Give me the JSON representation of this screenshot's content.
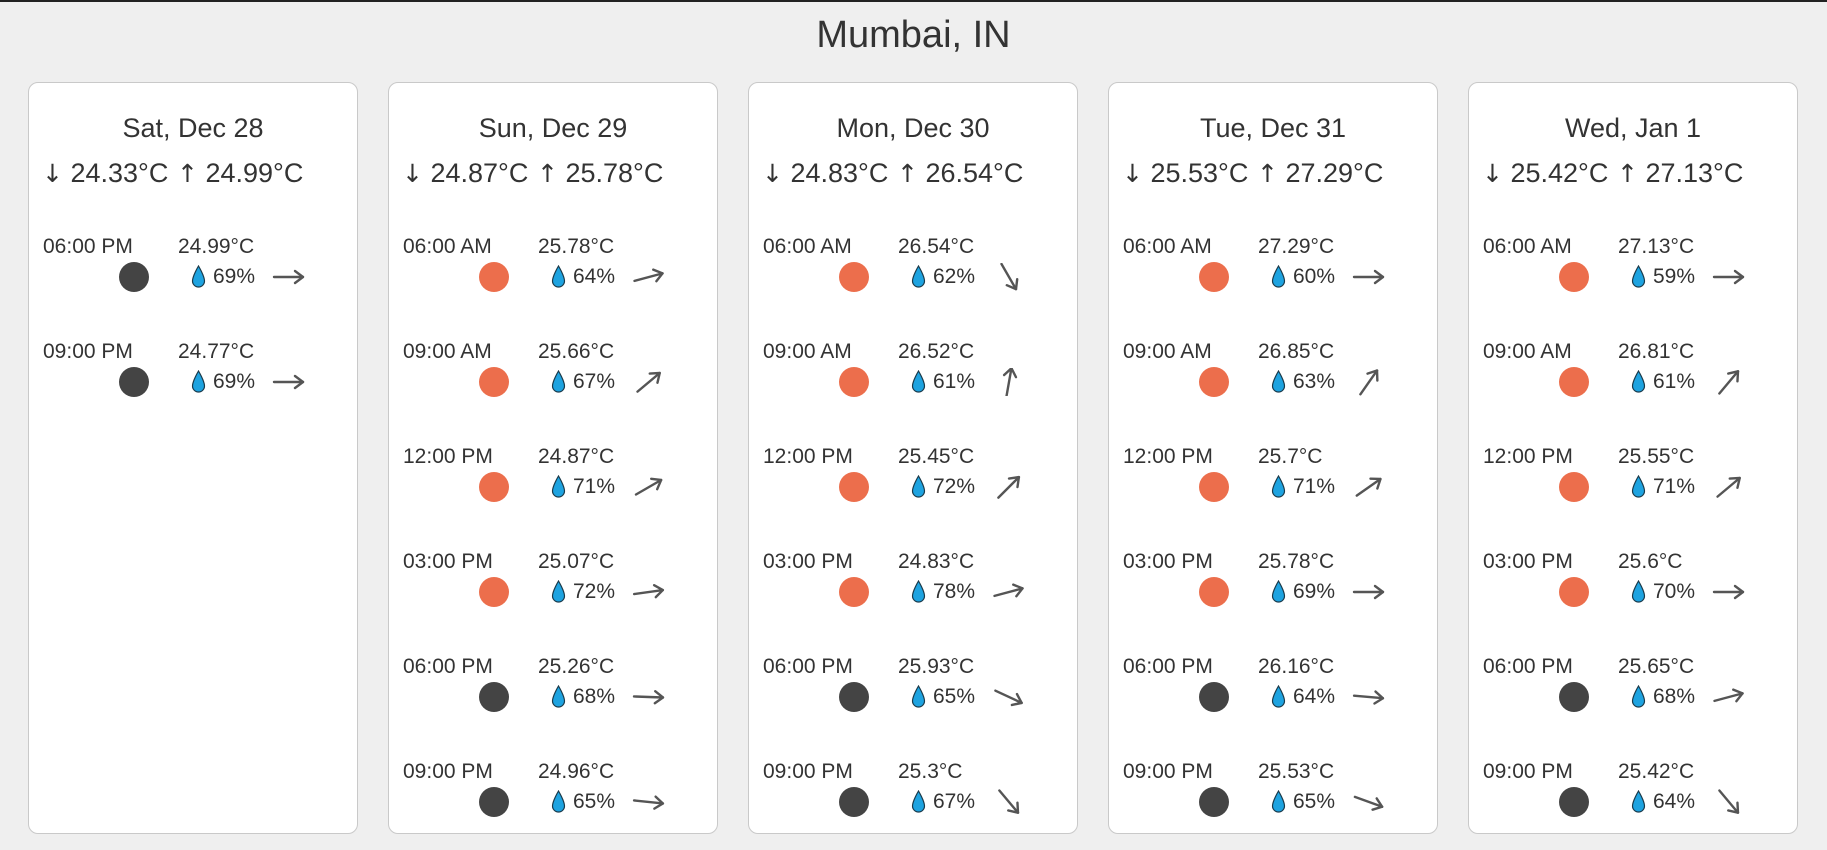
{
  "location": "Mumbai, IN",
  "colors": {
    "day": "#ec6e4c",
    "night": "#444444",
    "drop": "#1ea3e0",
    "arrow": "#555555"
  },
  "days": [
    {
      "date": "Sat, Dec 28",
      "min": "24.33°C",
      "max": "24.99°C",
      "slots": [
        {
          "time": "06:00 PM",
          "temp": "24.99°C",
          "humidity": "69%",
          "condition": "night",
          "wind_dir_deg": 0
        },
        {
          "time": "09:00 PM",
          "temp": "24.77°C",
          "humidity": "69%",
          "condition": "night",
          "wind_dir_deg": 0
        }
      ]
    },
    {
      "date": "Sun, Dec 29",
      "min": "24.87°C",
      "max": "25.78°C",
      "slots": [
        {
          "time": "06:00 AM",
          "temp": "25.78°C",
          "humidity": "64%",
          "condition": "day",
          "wind_dir_deg": -15
        },
        {
          "time": "09:00 AM",
          "temp": "25.66°C",
          "humidity": "67%",
          "condition": "day",
          "wind_dir_deg": -40
        },
        {
          "time": "12:00 PM",
          "temp": "24.87°C",
          "humidity": "71%",
          "condition": "day",
          "wind_dir_deg": -30
        },
        {
          "time": "03:00 PM",
          "temp": "25.07°C",
          "humidity": "72%",
          "condition": "day",
          "wind_dir_deg": -8
        },
        {
          "time": "06:00 PM",
          "temp": "25.26°C",
          "humidity": "68%",
          "condition": "night",
          "wind_dir_deg": 2
        },
        {
          "time": "09:00 PM",
          "temp": "24.96°C",
          "humidity": "65%",
          "condition": "night",
          "wind_dir_deg": 6
        }
      ]
    },
    {
      "date": "Mon, Dec 30",
      "min": "24.83°C",
      "max": "26.54°C",
      "slots": [
        {
          "time": "06:00 AM",
          "temp": "26.54°C",
          "humidity": "62%",
          "condition": "day",
          "wind_dir_deg": 60
        },
        {
          "time": "09:00 AM",
          "temp": "26.52°C",
          "humidity": "61%",
          "condition": "day",
          "wind_dir_deg": -80
        },
        {
          "time": "12:00 PM",
          "temp": "25.45°C",
          "humidity": "72%",
          "condition": "day",
          "wind_dir_deg": -45
        },
        {
          "time": "03:00 PM",
          "temp": "24.83°C",
          "humidity": "78%",
          "condition": "day",
          "wind_dir_deg": -15
        },
        {
          "time": "06:00 PM",
          "temp": "25.93°C",
          "humidity": "65%",
          "condition": "night",
          "wind_dir_deg": 25
        },
        {
          "time": "09:00 PM",
          "temp": "25.3°C",
          "humidity": "67%",
          "condition": "night",
          "wind_dir_deg": 50
        }
      ]
    },
    {
      "date": "Tue, Dec 31",
      "min": "25.53°C",
      "max": "27.29°C",
      "slots": [
        {
          "time": "06:00 AM",
          "temp": "27.29°C",
          "humidity": "60%",
          "condition": "day",
          "wind_dir_deg": 0
        },
        {
          "time": "09:00 AM",
          "temp": "26.85°C",
          "humidity": "63%",
          "condition": "day",
          "wind_dir_deg": -55
        },
        {
          "time": "12:00 PM",
          "temp": "25.7°C",
          "humidity": "71%",
          "condition": "day",
          "wind_dir_deg": -35
        },
        {
          "time": "03:00 PM",
          "temp": "25.78°C",
          "humidity": "69%",
          "condition": "day",
          "wind_dir_deg": 0
        },
        {
          "time": "06:00 PM",
          "temp": "26.16°C",
          "humidity": "64%",
          "condition": "night",
          "wind_dir_deg": 5
        },
        {
          "time": "09:00 PM",
          "temp": "25.53°C",
          "humidity": "65%",
          "condition": "night",
          "wind_dir_deg": 20
        }
      ]
    },
    {
      "date": "Wed, Jan 1",
      "min": "25.42°C",
      "max": "27.13°C",
      "slots": [
        {
          "time": "06:00 AM",
          "temp": "27.13°C",
          "humidity": "59%",
          "condition": "day",
          "wind_dir_deg": 0
        },
        {
          "time": "09:00 AM",
          "temp": "26.81°C",
          "humidity": "61%",
          "condition": "day",
          "wind_dir_deg": -50
        },
        {
          "time": "12:00 PM",
          "temp": "25.55°C",
          "humidity": "71%",
          "condition": "day",
          "wind_dir_deg": -40
        },
        {
          "time": "03:00 PM",
          "temp": "25.6°C",
          "humidity": "70%",
          "condition": "day",
          "wind_dir_deg": 0
        },
        {
          "time": "06:00 PM",
          "temp": "25.65°C",
          "humidity": "68%",
          "condition": "night",
          "wind_dir_deg": -15
        },
        {
          "time": "09:00 PM",
          "temp": "25.42°C",
          "humidity": "64%",
          "condition": "night",
          "wind_dir_deg": 50
        }
      ]
    }
  ]
}
